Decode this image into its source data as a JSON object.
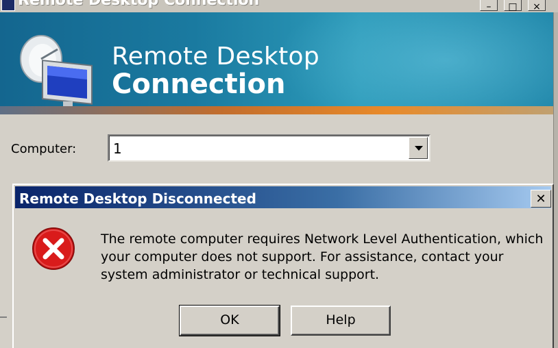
{
  "window": {
    "title": "Remote Desktop Connection"
  },
  "banner": {
    "line1": "Remote Desktop",
    "line2": "Connection",
    "icon": "remote-desktop-monitor-icon"
  },
  "form": {
    "computer_label": "Computer:",
    "computer_value": "1"
  },
  "dialog": {
    "title": "Remote Desktop Disconnected",
    "close_glyph": "✕",
    "icon": "error-icon",
    "message": "The remote computer requires Network Level Authentication, which your computer does not support. For assistance, contact your system administrator or technical support.",
    "ok_label": "OK",
    "help_label": "Help"
  },
  "colors": {
    "banner": "#1a7aa0",
    "dialog_title_start": "#0a246a",
    "dialog_title_end": "#a6caf0",
    "error_red": "#d91b1b",
    "window_face": "#d4d0c8"
  }
}
